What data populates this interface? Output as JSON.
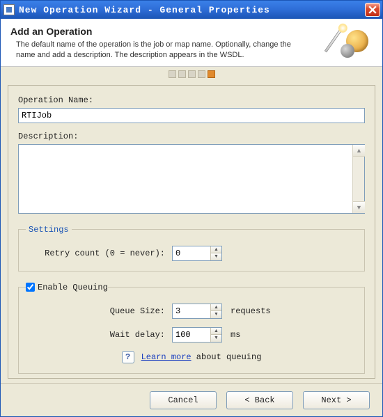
{
  "window": {
    "title": "New Operation Wizard - General Properties"
  },
  "header": {
    "heading": "Add an Operation",
    "description": "The default name of the operation is the job or map name. Optionally, change the name and add a description. The description appears in the WSDL."
  },
  "steps": {
    "count": 5,
    "active_index": 4
  },
  "form": {
    "operation_name_label": "Operation Name:",
    "operation_name_value": "RTIJob",
    "description_label": "Description:",
    "description_value": ""
  },
  "settings": {
    "legend": "Settings",
    "retry_label": "Retry count (0 = never):",
    "retry_value": "0"
  },
  "queuing": {
    "enable_label": "Enable Queuing",
    "enabled": true,
    "queue_size_label": "Queue Size:",
    "queue_size_value": "3",
    "queue_size_unit": "requests",
    "wait_delay_label": "Wait delay:",
    "wait_delay_value": "100",
    "wait_delay_unit": "ms",
    "learn_link": "Learn more",
    "learn_suffix": " about queuing"
  },
  "buttons": {
    "cancel": "Cancel",
    "back": "< Back",
    "next": "Next >"
  }
}
